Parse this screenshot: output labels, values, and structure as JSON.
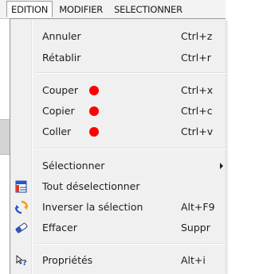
{
  "menubar": {
    "items": [
      {
        "label": "EDITION"
      },
      {
        "label": "MODIFIER"
      },
      {
        "label": "SELECTIONNER"
      }
    ]
  },
  "menu": {
    "annuler": {
      "label": "Annuler",
      "shortcut": "Ctrl+z"
    },
    "retablir": {
      "label": "Rétablir",
      "shortcut": "Ctrl+r"
    },
    "couper": {
      "label": "Couper",
      "shortcut": "Ctrl+x",
      "marker_color": "#ff0000"
    },
    "copier": {
      "label": "Copier",
      "shortcut": "Ctrl+c",
      "marker_color": "#ff0000"
    },
    "coller": {
      "label": "Coller",
      "shortcut": "Ctrl+v",
      "marker_color": "#ff0000"
    },
    "selectionner": {
      "label": "Sélectionner",
      "submenu": true
    },
    "tout_deselectionner": {
      "label": "Tout déselectionner",
      "icon": "deselect-grid-icon"
    },
    "inverser_selection": {
      "label": "Inverser la sélection",
      "shortcut": "Alt+F9",
      "icon": "invert-selection-icon"
    },
    "effacer": {
      "label": "Effacer",
      "shortcut": "Suppr",
      "icon": "eraser-icon"
    },
    "proprietes": {
      "label": "Propriétés",
      "shortcut": "Alt+i",
      "icon": "properties-icon"
    }
  }
}
